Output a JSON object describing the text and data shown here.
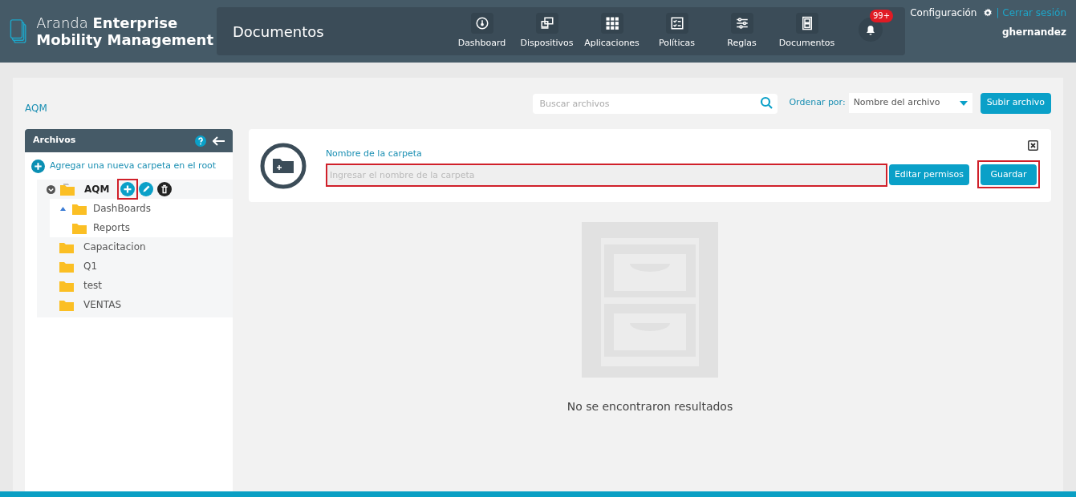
{
  "brand": {
    "light": "Aranda",
    "bold_line1": "Enterprise",
    "bold_line2": "Mobility Management"
  },
  "page_title": "Documentos",
  "nav": [
    {
      "label": "Dashboard",
      "selected": false
    },
    {
      "label": "Dispositivos",
      "selected": false
    },
    {
      "label": "Aplicaciones",
      "selected": false
    },
    {
      "label": "Políticas",
      "selected": false
    },
    {
      "label": "Reglas",
      "selected": false
    },
    {
      "label": "Documentos",
      "selected": false
    }
  ],
  "notifications": {
    "badge": "99+"
  },
  "user": {
    "settings": "Configuración",
    "logout": "| Cerrar sesión",
    "name": "ghernandez"
  },
  "breadcrumb": "AQM",
  "search": {
    "placeholder": "Buscar archivos"
  },
  "sort": {
    "label": "Ordenar por:",
    "value": "Nombre del archivo"
  },
  "upload_button": "Subir archivo",
  "sidebar": {
    "title": "Archivos",
    "add_root": "Agregar una nueva carpeta en el root",
    "tree": [
      {
        "name": "AQM",
        "expanded": true,
        "selected": true,
        "actions": [
          {
            "kind": "add",
            "highlighted": true
          },
          {
            "kind": "edit",
            "highlighted": false
          },
          {
            "kind": "delete",
            "highlighted": false
          }
        ],
        "children": [
          {
            "name": "DashBoards",
            "pointer": true,
            "selected": false
          },
          {
            "name": "Reports",
            "pointer": false,
            "selected": false
          }
        ]
      },
      {
        "name": "Capacitacion",
        "expanded": false,
        "selected": false
      },
      {
        "name": "Q1",
        "expanded": false,
        "selected": false
      },
      {
        "name": "test",
        "expanded": false,
        "selected": false
      },
      {
        "name": "VENTAS",
        "expanded": false,
        "selected": false
      }
    ]
  },
  "folder_form": {
    "label": "Nombre de la carpeta",
    "placeholder": "Ingresar el nombre de la carpeta",
    "field_highlighted": true,
    "buttons": [
      {
        "label": "Editar permisos",
        "highlighted": false
      },
      {
        "label": "Guardar",
        "highlighted": true
      }
    ]
  },
  "empty_state": "No se encontraron resultados"
}
